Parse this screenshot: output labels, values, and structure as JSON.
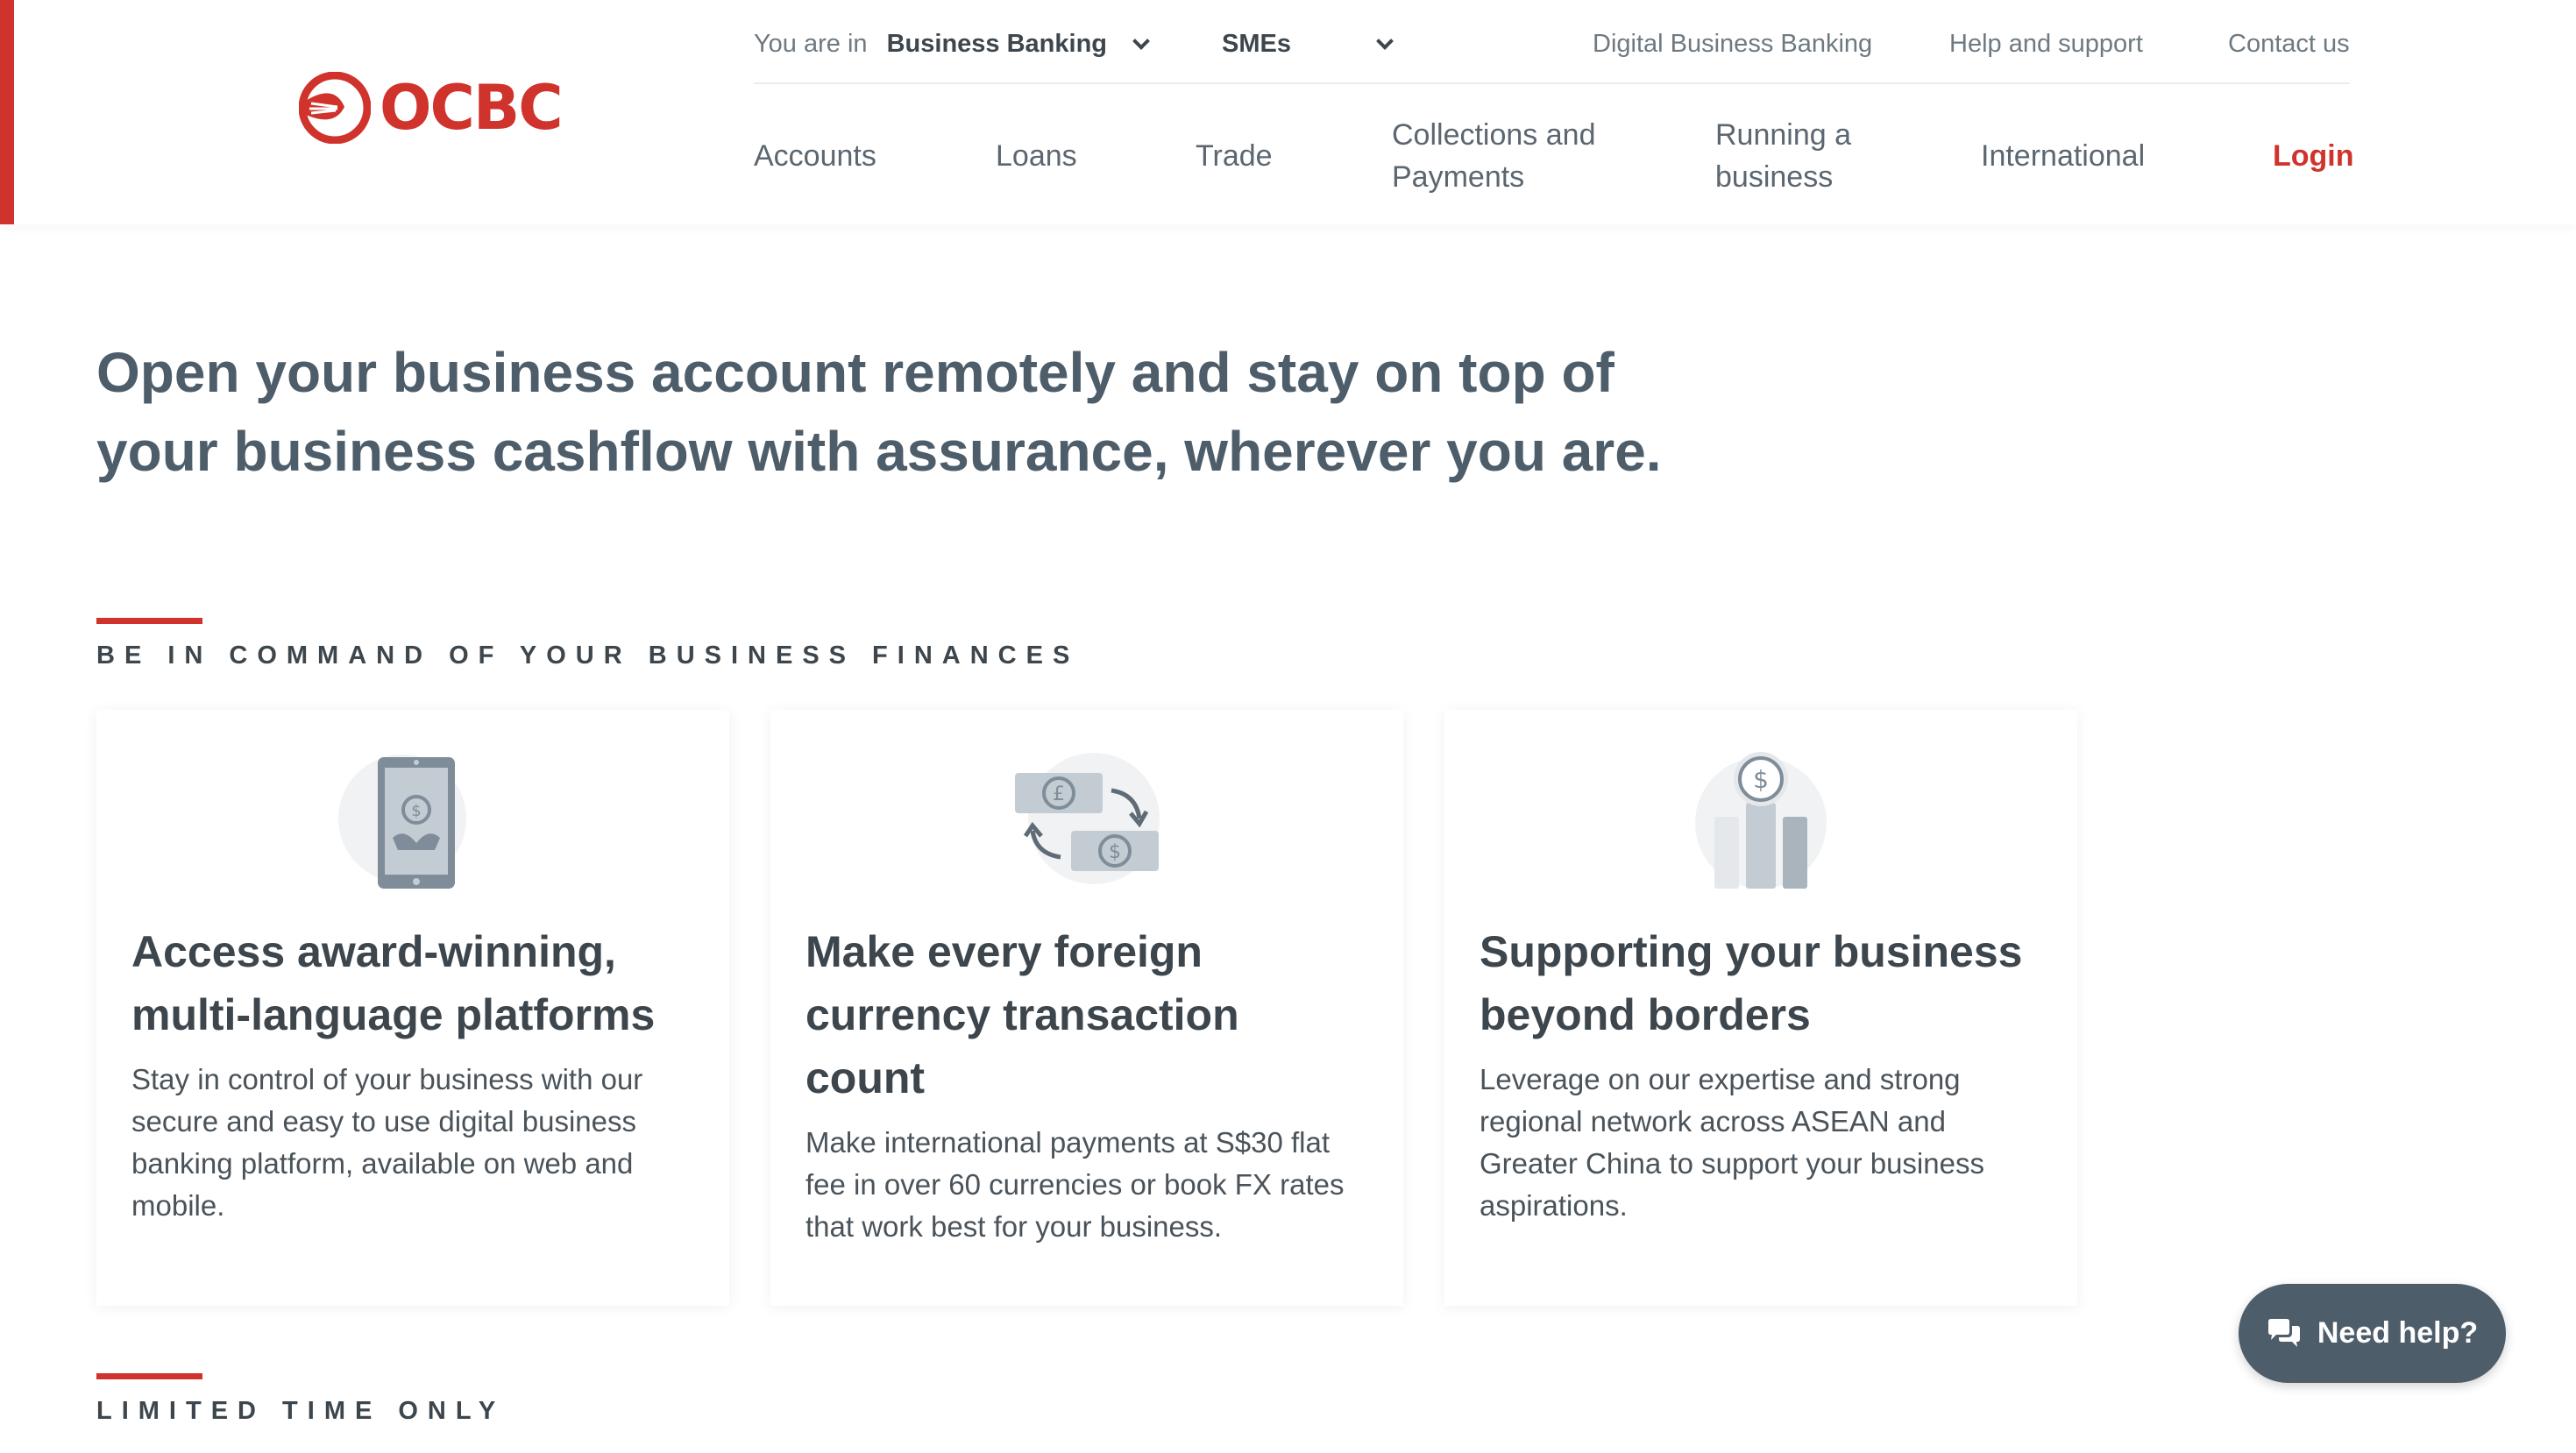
{
  "brand": {
    "name": "OCBC",
    "accent": "#d0332c"
  },
  "util_nav": {
    "you_are_in": "You are in",
    "segment": "Business Banking",
    "sub_segment": "SMEs",
    "links": [
      "Digital Business Banking",
      "Help and support",
      "Contact us"
    ]
  },
  "main_nav": {
    "items": [
      {
        "line1": "Accounts",
        "line2": ""
      },
      {
        "line1": "Loans",
        "line2": ""
      },
      {
        "line1": "Trade",
        "line2": ""
      },
      {
        "line1": "Collections and",
        "line2": "Payments"
      },
      {
        "line1": "Running a",
        "line2": "business"
      },
      {
        "line1": "International",
        "line2": ""
      }
    ],
    "login": "Login"
  },
  "hero": {
    "line1": "Open your business account remotely and stay on top of",
    "line2": "your business cashflow with assurance, wherever you are."
  },
  "section1": {
    "title": "BE IN COMMAND OF YOUR BUSINESS FINANCES",
    "cards": [
      {
        "icon": "mobile-banking-icon",
        "title_lines": [
          "Access award-winning,",
          "multi-language platforms"
        ],
        "body_lines": [
          "Stay in control of your business with our",
          "secure and easy to use digital business",
          "banking platform, available on web and",
          "mobile."
        ]
      },
      {
        "icon": "currency-exchange-icon",
        "title_lines": [
          "Make every foreign",
          "currency transaction",
          "count"
        ],
        "body_lines": [
          "Make international payments at S$30 flat",
          "fee in over 60 currencies or book FX rates",
          "that work best for your business."
        ]
      },
      {
        "icon": "business-growth-icon",
        "title_lines": [
          "Supporting your business",
          "beyond borders"
        ],
        "body_lines": [
          "Leverage on our expertise and strong",
          "regional network across ASEAN and",
          "Greater China to support your business",
          "aspirations."
        ]
      }
    ]
  },
  "section2": {
    "title": "LIMITED TIME ONLY"
  },
  "help": {
    "label": "Need help?",
    "icon": "chat-icon"
  }
}
